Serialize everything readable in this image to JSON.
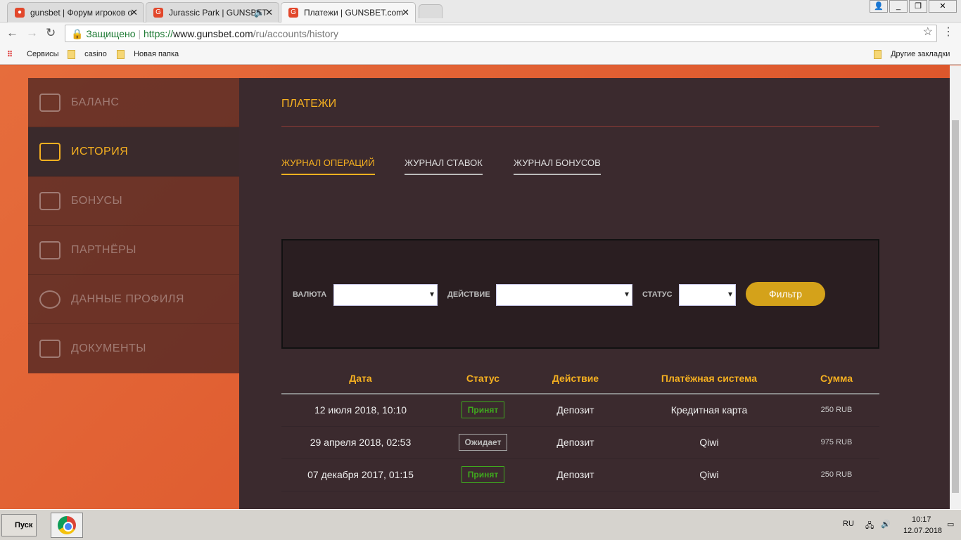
{
  "browser": {
    "tabs": [
      {
        "title": "gunsbet | Форум игроков о",
        "active": false
      },
      {
        "title": "Jurassic Park | GUNSBET",
        "active": false
      },
      {
        "title": "Платежи | GUNSBET.com",
        "active": true
      }
    ],
    "secure_label": "Защищено",
    "url_scheme": "https://",
    "url_host": "www.gunsbet.com",
    "url_path": "/ru/accounts/history",
    "bookmarks": [
      "Сервисы",
      "casino",
      "Новая папка"
    ],
    "other_bookmarks": "Другие закладки"
  },
  "sidebar": {
    "items": [
      {
        "label": "БАЛАНС",
        "icon": "wallet-icon",
        "active": false
      },
      {
        "label": "ИСТОРИЯ",
        "icon": "calendar-clock-icon",
        "active": true
      },
      {
        "label": "БОНУСЫ",
        "icon": "gift-icon",
        "active": false
      },
      {
        "label": "ПАРТНЁРЫ",
        "icon": "megaphone-icon",
        "active": false
      },
      {
        "label": "ДАННЫЕ ПРОФИЛЯ",
        "icon": "user-icon",
        "active": false
      },
      {
        "label": "ДОКУМЕНТЫ",
        "icon": "id-card-icon",
        "active": false
      }
    ]
  },
  "main": {
    "title": "ПЛАТЕЖИ",
    "tabs": [
      "ЖУРНАЛ ОПЕРАЦИЙ",
      "ЖУРНАЛ СТАВОК",
      "ЖУРНАЛ БОНУСОВ"
    ],
    "filter": {
      "currency_label": "ВАЛЮТА",
      "action_label": "ДЕЙСТВИЕ",
      "status_label": "СТАТУС",
      "button": "Фильтр"
    },
    "table": {
      "headers": [
        "Дата",
        "Статус",
        "Действие",
        "Платёжная система",
        "Сумма"
      ],
      "rows": [
        {
          "date": "12 июля 2018, 10:10",
          "status": "Принят",
          "action": "Депозит",
          "system": "Кредитная карта",
          "amount": "250 RUB"
        },
        {
          "date": "29 апреля 2018, 02:53",
          "status": "Ожидает",
          "action": "Депозит",
          "system": "Qiwi",
          "amount": "975 RUB"
        },
        {
          "date": "07 декабря 2017, 01:15",
          "status": "Принят",
          "action": "Депозит",
          "system": "Qiwi",
          "amount": "250 RUB"
        }
      ]
    }
  },
  "taskbar": {
    "start": "Пуск",
    "lang": "RU",
    "time": "10:17",
    "date": "12.07.2018"
  },
  "colors": {
    "accent": "#f5b020",
    "button": "#d4a21a",
    "accepted": "#3fa91e"
  }
}
